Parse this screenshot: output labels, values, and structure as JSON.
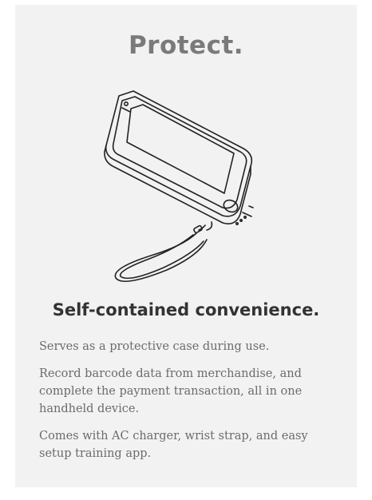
{
  "card": {
    "title": "Protect.",
    "subtitle": "Self-contained convenience.",
    "paragraphs": [
      "Serves as a protective case during use.",
      "Record barcode data from merchandise, and complete the payment transaction, all in one handheld device.",
      "Comes with AC charger, wrist strap, and easy setup training app."
    ],
    "illustration_icon": "phone-case-with-wrist-strap-icon"
  }
}
